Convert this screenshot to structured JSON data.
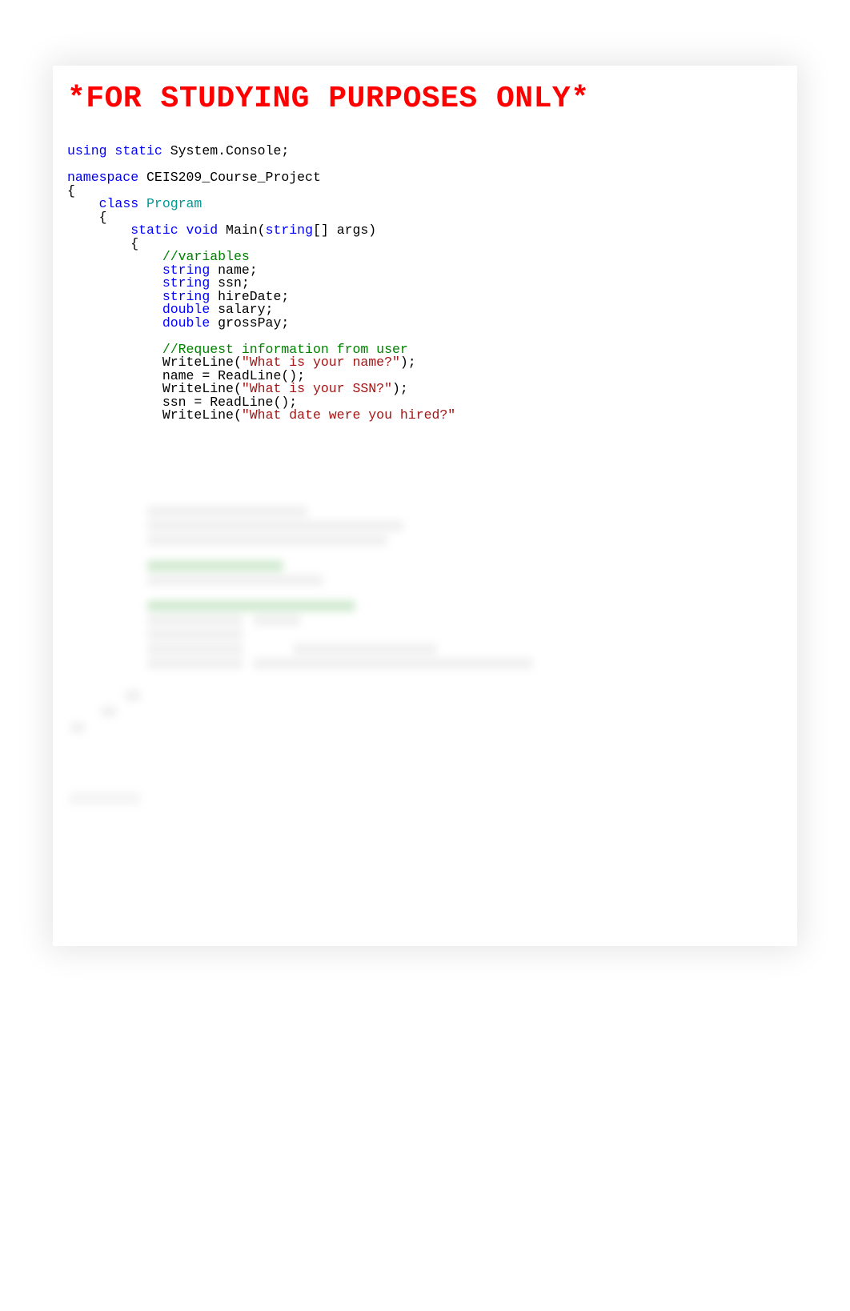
{
  "title": "*FOR STUDYING PURPOSES ONLY*",
  "code": {
    "using_kw": "using",
    "static_kw": "static",
    "system_console": " System.Console;",
    "namespace_kw": "namespace",
    "namespace_name": " CEIS209_Course_Project",
    "lbrace": "{",
    "rbrace": "}",
    "class_kw": "class",
    "class_name": " Program",
    "static_kw2": "static",
    "void_kw": "void",
    "main": " Main(",
    "string_kw": "string",
    "args": "[] args)",
    "cmt_vars": "//variables",
    "decl_name": " name;",
    "decl_ssn": " ssn;",
    "decl_hireDate": " hireDate;",
    "double_kw": "double",
    "decl_salary": " salary;",
    "decl_grossPay": " grossPay;",
    "cmt_req": "//Request information from user",
    "wl": "WriteLine(",
    "s_name_q": "\"What is your name?\"",
    "close_paren": ");",
    "name_assign": "name = ReadLine();",
    "s_ssn_q": "\"What is your SSN?\"",
    "ssn_assign": "ssn = ReadLine();",
    "s_hire_q": "\"What date were you hired?\""
  }
}
